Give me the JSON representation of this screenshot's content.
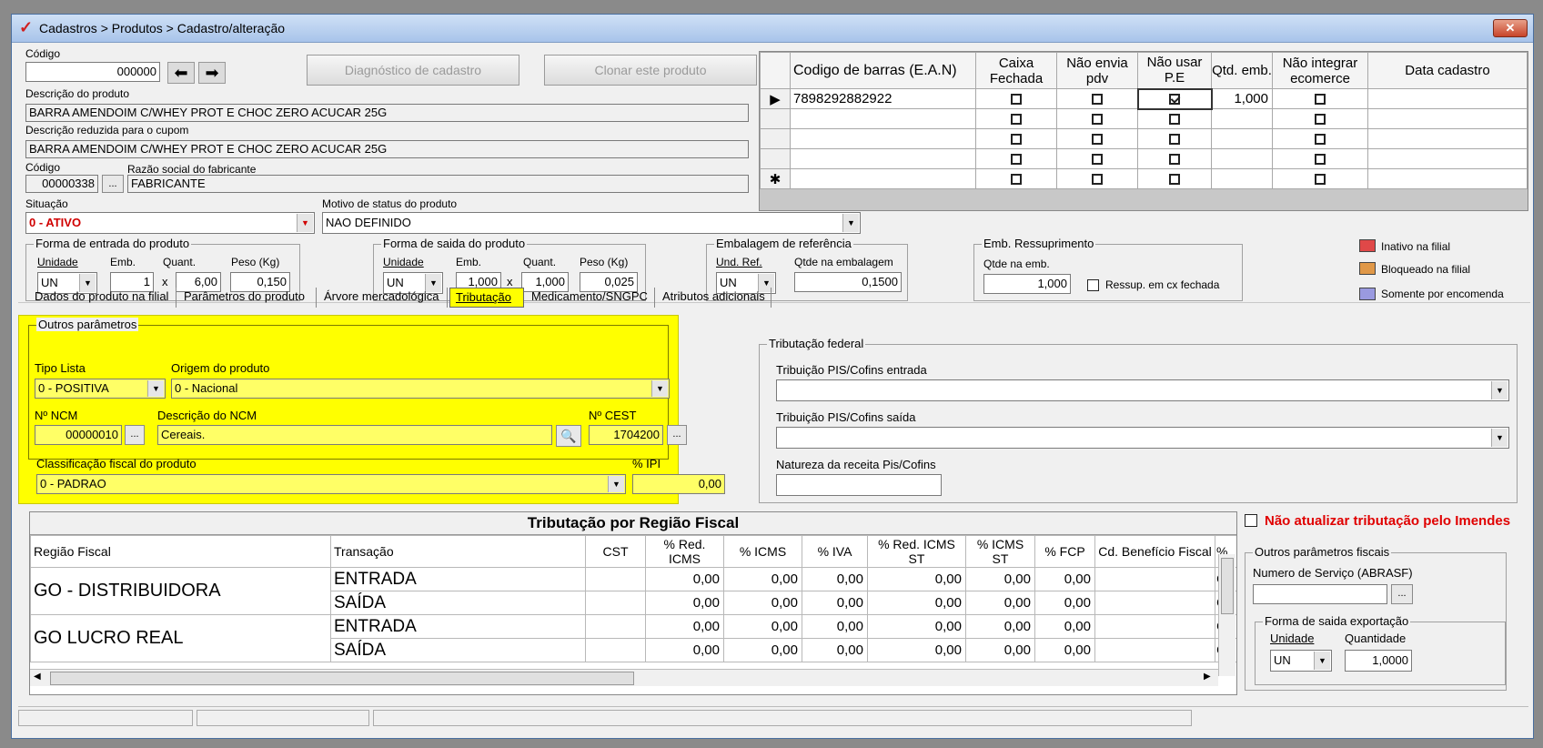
{
  "window": {
    "title": "Cadastros > Produtos > Cadastro/alteração",
    "close_label": "✕"
  },
  "product": {
    "code_label": "Código",
    "code_value": "000000",
    "diagnostic_button": "Diagnóstico de cadastro",
    "clone_button": "Clonar este produto",
    "description_label": "Descrição  do produto",
    "description_value": "BARRA AMENDOIM C/WHEY PROT E CHOC ZERO ACUCAR 25G",
    "short_description_label": "Descrição reduzida para o cupom",
    "short_description_value": "BARRA AMENDOIM C/WHEY PROT E CHOC ZERO ACUCAR 25G",
    "manufacturer_code_label": "Código",
    "manufacturer_code_value": "00000338",
    "manufacturer_name_label": "Razão social do fabricante",
    "manufacturer_name_value": "FABRICANTE",
    "status_label": "Situação",
    "status_value": "0 - ATIVO",
    "status_reason_label": "Motivo de status do produto",
    "status_reason_value": "NAO DEFINIDO"
  },
  "barcode_table": {
    "headers": {
      "ean": "Codigo de barras (E.A.N)",
      "box": "Caixa Fechada",
      "no_pdv": "Não envia pdv",
      "no_pe": "Não usar P.E",
      "qty": "Qtd. emb.",
      "no_ecom": "Não integrar ecomerce",
      "date": "Data cadastro"
    },
    "row1": {
      "ean": "7898292882922",
      "qty": "1,000",
      "pe_checked": true
    }
  },
  "entry_form": {
    "title": "Forma de entrada do produto",
    "unit_label": "Unidade",
    "emb_label": "Emb.",
    "qty_label": "Quant.",
    "weight_label": "Peso (Kg)",
    "unit_value": "UN",
    "emb_value": "1",
    "qty_value": "6,00",
    "weight_value": "0,150",
    "x": "x"
  },
  "exit_form": {
    "title": "Forma de saida do produto",
    "unit_label": "Unidade",
    "emb_label": "Emb.",
    "qty_label": "Quant.",
    "weight_label": "Peso (Kg)",
    "unit_value": "UN",
    "emb_value": "1,000",
    "qty_value": "1,000",
    "weight_value": "0,025",
    "x": "x"
  },
  "reference_pack": {
    "title": "Embalagem de referência",
    "unit_label": "Und. Ref.",
    "qty_label": "Qtde na embalagem",
    "unit_value": "UN",
    "qty_value": "0,1500"
  },
  "resupply": {
    "title": "Emb. Ressuprimento",
    "qty_label": "Qtde na emb.",
    "qty_value": "1,000",
    "closed_box_label": "Ressup. em cx fechada"
  },
  "legend": {
    "inactive": "Inativo na filial",
    "blocked": "Bloqueado na filial",
    "order_only": "Somente por encomenda",
    "inactive_color": "#e04848",
    "blocked_color": "#e09848",
    "order_color": "#9a9ae0"
  },
  "tabs": [
    "Dados do produto na filial",
    "Parâmetros do produto",
    "Árvore mercadológica",
    "Tributação",
    "Medicamento/SNGPC",
    "Atributos adicionais"
  ],
  "other_params": {
    "title": "Outros parâmetros",
    "list_type_label": "Tipo Lista",
    "list_type_value": "0 - POSITIVA",
    "origin_label": "Origem do produto",
    "origin_value": "0 - Nacional",
    "ncm_label": "Nº NCM",
    "ncm_value": "00000010",
    "ncm_desc_label": "Descrição do NCM",
    "ncm_desc_value": "Cereais.",
    "cest_label": "Nº CEST",
    "cest_value": "1704200",
    "fiscal_class_label": "Classificação fiscal do produto",
    "fiscal_class_value": "0 - PADRAO",
    "ipi_label": "% IPI",
    "ipi_value": "0,00"
  },
  "federal": {
    "title": "Tributação federal",
    "pis_in_label": "Tribuição PIS/Cofins entrada",
    "pis_out_label": "Tribuição PIS/Cofins saída",
    "nature_label": "Natureza da receita Pis/Cofins"
  },
  "region_table": {
    "title": "Tributação por Região Fiscal",
    "headers": {
      "region": "Região Fiscal",
      "transaction": "Transação",
      "cst": "CST",
      "red_icms": "% Red. ICMS",
      "icms": "% ICMS",
      "iva": "% IVA",
      "red_icms_st": "% Red. ICMS ST",
      "icms_st": "% ICMS ST",
      "fcp": "% FCP",
      "benefit": "Cd. Benefício Fiscal",
      "more": "%"
    },
    "rows": [
      {
        "region": "GO - DISTRIBUIDORA",
        "in": "ENTRADA",
        "out": "SAÍDA"
      },
      {
        "region": "GO LUCRO REAL",
        "in": "ENTRADA",
        "out": "SAÍDA"
      }
    ],
    "zero": "0,00",
    "partial": "C"
  },
  "imendes": {
    "label": "Não atualizar tributação pelo Imendes"
  },
  "fiscal_params": {
    "title": "Outros parâmetros fiscais",
    "service_label": "Numero de Serviço (ABRASF)",
    "export_title": "Forma de saida exportação",
    "unit_label": "Unidade",
    "qty_label": "Quantidade",
    "unit_value": "UN",
    "qty_value": "1,0000"
  },
  "icons": {
    "back": "arrow-left-icon",
    "forward": "arrow-right-icon",
    "search": "magnifier-icon",
    "row_pointer": "row-pointer-icon",
    "new_row": "new-row-icon"
  }
}
